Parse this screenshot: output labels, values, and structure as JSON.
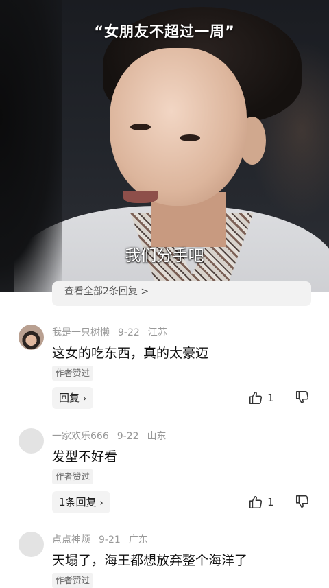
{
  "video": {
    "top_caption": "“女朋友不超过一周”",
    "subtitle": "我们分手吧"
  },
  "peek_bar": {
    "text": "查看全部2条回复 >"
  },
  "comments": [
    {
      "user": "我是一只树懒",
      "date": "9-22",
      "location": "江苏",
      "text": "这女的吃东西，真的太豪迈",
      "badge": "作者赞过",
      "reply_label": "回复",
      "reply_chevron": "›",
      "likes": "1"
    },
    {
      "user": "一家欢乐666",
      "date": "9-22",
      "location": "山东",
      "text": "发型不好看",
      "badge": "作者赞过",
      "reply_label": "1条回复",
      "reply_chevron": "›",
      "likes": "1"
    },
    {
      "user": "点点神烦",
      "date": "9-21",
      "location": "广东",
      "text": "天塌了，海王都想放弃整个海洋了",
      "badge": "作者赞过"
    }
  ],
  "icons": {
    "like": "thumbs-up-icon",
    "dislike": "thumbs-down-icon",
    "chevron": "chevron-right-icon"
  }
}
